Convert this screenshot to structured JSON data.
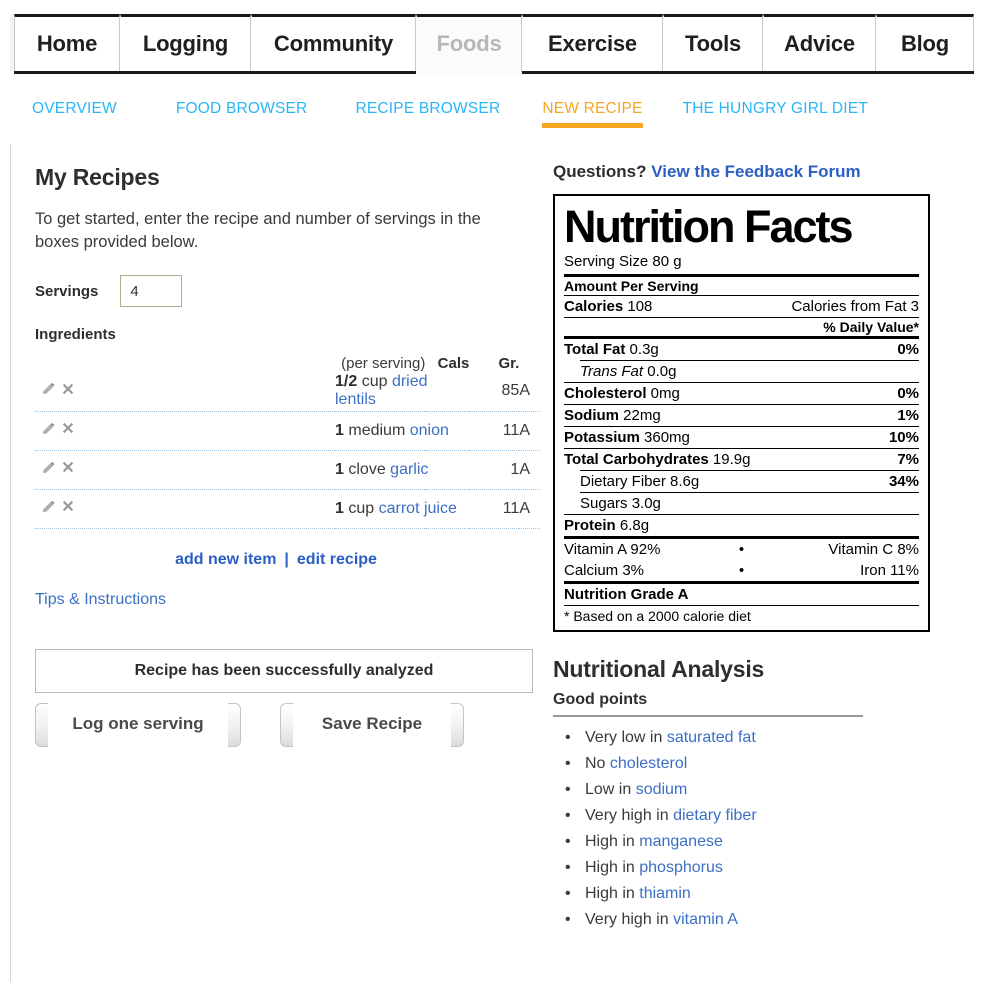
{
  "tabs": [
    {
      "label": "Home",
      "width_class": "w-home",
      "active": false
    },
    {
      "label": "Logging",
      "width_class": "w-logging",
      "active": false
    },
    {
      "label": "Community",
      "width_class": "w-community",
      "active": false
    },
    {
      "label": "Foods",
      "width_class": "w-foods",
      "active": true
    },
    {
      "label": "Exercise",
      "width_class": "w-exercise",
      "active": false
    },
    {
      "label": "Tools",
      "width_class": "w-tools",
      "active": false
    },
    {
      "label": "Advice",
      "width_class": "w-advice",
      "active": false
    },
    {
      "label": "Blog",
      "width_class": "w-blog",
      "active": false
    }
  ],
  "subnav": [
    {
      "label": "OVERVIEW",
      "active": false
    },
    {
      "label": "FOOD BROWSER",
      "active": false
    },
    {
      "label": "RECIPE BROWSER",
      "active": false
    },
    {
      "label": "NEW RECIPE",
      "active": true
    },
    {
      "label": "THE HUNGRY GIRL DIET",
      "active": false
    }
  ],
  "left": {
    "page_title": "My Recipes",
    "intro": "To get started, enter the recipe and number of servings in the boxes provided below.",
    "servings_label": "Servings",
    "servings_value": "4",
    "ingredients_label": "Ingredients",
    "table_headers": {
      "per_serving": "(per serving)",
      "cals": "Cals",
      "gr": "Gr."
    },
    "ingredients": [
      {
        "qty": "1/2",
        "unit": "cup",
        "food": "dried lentils",
        "cals": "85",
        "gr": "A"
      },
      {
        "qty": "1",
        "unit": "medium",
        "food": "onion",
        "cals": "11",
        "gr": "A"
      },
      {
        "qty": "1",
        "unit": "clove",
        "food": "garlic",
        "cals": "1",
        "gr": "A"
      },
      {
        "qty": "1",
        "unit": "cup",
        "food": "carrot juice",
        "cals": "11",
        "gr": "A"
      }
    ],
    "add_new_item": "add new item",
    "link_separator": "|",
    "edit_recipe": "edit recipe",
    "tips_link": "Tips & Instructions",
    "status_message": "Recipe has been successfully analyzed",
    "log_button": "Log one serving",
    "save_button": "Save Recipe"
  },
  "right": {
    "questions_prefix": "Questions?",
    "questions_link": "View the Feedback Forum",
    "nutrition_facts": {
      "title": "Nutrition Facts",
      "serving_size": "Serving Size 80 g",
      "amount_per_serving": "Amount Per Serving",
      "calories_label": "Calories",
      "calories_value": "108",
      "calories_from_fat": "Calories from Fat 3",
      "daily_value_header": "% Daily Value*",
      "rows": [
        {
          "name": "Total Fat",
          "value": "0.3g",
          "dv": "0%",
          "bold": true,
          "indent": false
        },
        {
          "name": "Trans Fat",
          "value": "0.0g",
          "dv": "",
          "bold": false,
          "indent": true,
          "italic_name": true
        },
        {
          "name": "Cholesterol",
          "value": "0mg",
          "dv": "0%",
          "bold": true,
          "indent": false
        },
        {
          "name": "Sodium",
          "value": "22mg",
          "dv": "1%",
          "bold": true,
          "indent": false
        },
        {
          "name": "Potassium",
          "value": "360mg",
          "dv": "10%",
          "bold": true,
          "indent": false
        },
        {
          "name": "Total Carbohydrates",
          "value": "19.9g",
          "dv": "7%",
          "bold": true,
          "indent": false
        },
        {
          "name": "Dietary Fiber",
          "value": "8.6g",
          "dv": "34%",
          "bold": false,
          "indent": true
        },
        {
          "name": "Sugars",
          "value": "3.0g",
          "dv": "",
          "bold": false,
          "indent": true
        },
        {
          "name": "Protein",
          "value": "6.8g",
          "dv": "",
          "bold": true,
          "indent": false
        }
      ],
      "vitamins": [
        {
          "left": "Vitamin A 92%",
          "mid": "•",
          "right": "Vitamin C 8%"
        },
        {
          "left": "Calcium 3%",
          "mid": "•",
          "right": "Iron 11%"
        }
      ],
      "grade": "Nutrition Grade A",
      "footnote": "* Based on a 2000 calorie diet"
    },
    "analysis": {
      "title": "Nutritional Analysis",
      "subtitle": "Good points",
      "points": [
        {
          "text": "Very low in ",
          "link": "saturated fat"
        },
        {
          "text": "No ",
          "link": "cholesterol"
        },
        {
          "text": "Low in ",
          "link": "sodium"
        },
        {
          "text": "Very high in ",
          "link": "dietary fiber"
        },
        {
          "text": "High in ",
          "link": "manganese"
        },
        {
          "text": "High in ",
          "link": "phosphorus"
        },
        {
          "text": "High in ",
          "link": "thiamin"
        },
        {
          "text": "Very high in ",
          "link": "vitamin A"
        }
      ]
    }
  },
  "colors": {
    "link_blue": "#3c6fc4",
    "subnav_blue": "#29b6f6",
    "accent_orange": "#f5a623",
    "text_dark": "#2e2e2e"
  },
  "icons": {
    "edit": "pencil-icon",
    "delete": "close-x-icon"
  }
}
